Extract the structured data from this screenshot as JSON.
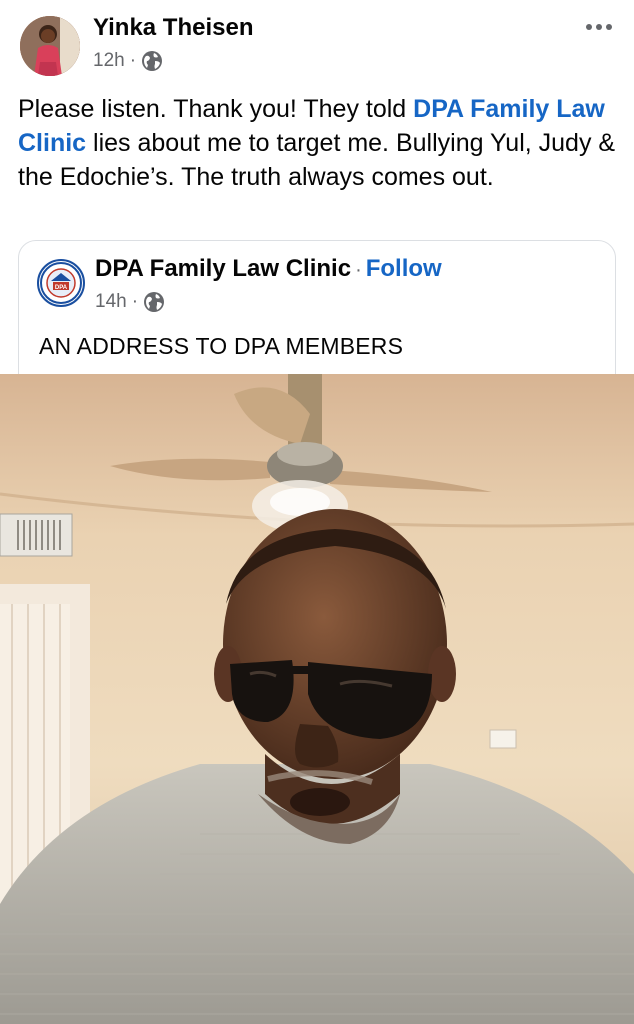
{
  "post": {
    "author": "Yinka Theisen",
    "time": "12h",
    "separator": "·",
    "privacy_icon": "globe-icon",
    "more_icon": "more-options-icon",
    "text_before": "Please listen. Thank you! They told ",
    "mention": "DPA Family Law Clinic",
    "text_after": " lies about me to target me. Bullying Yul, Judy & the Edochie’s. The truth always comes out."
  },
  "shared": {
    "page_name": "DPA Family Law Clinic",
    "separator": "·",
    "follow_label": "Follow",
    "time": "14h",
    "privacy_icon": "globe-icon",
    "caption": "AN ADDRESS TO DPA MEMBERS",
    "logo_text": "DPA"
  },
  "colors": {
    "link": "#1666c5",
    "secondary_text": "#65676b"
  }
}
